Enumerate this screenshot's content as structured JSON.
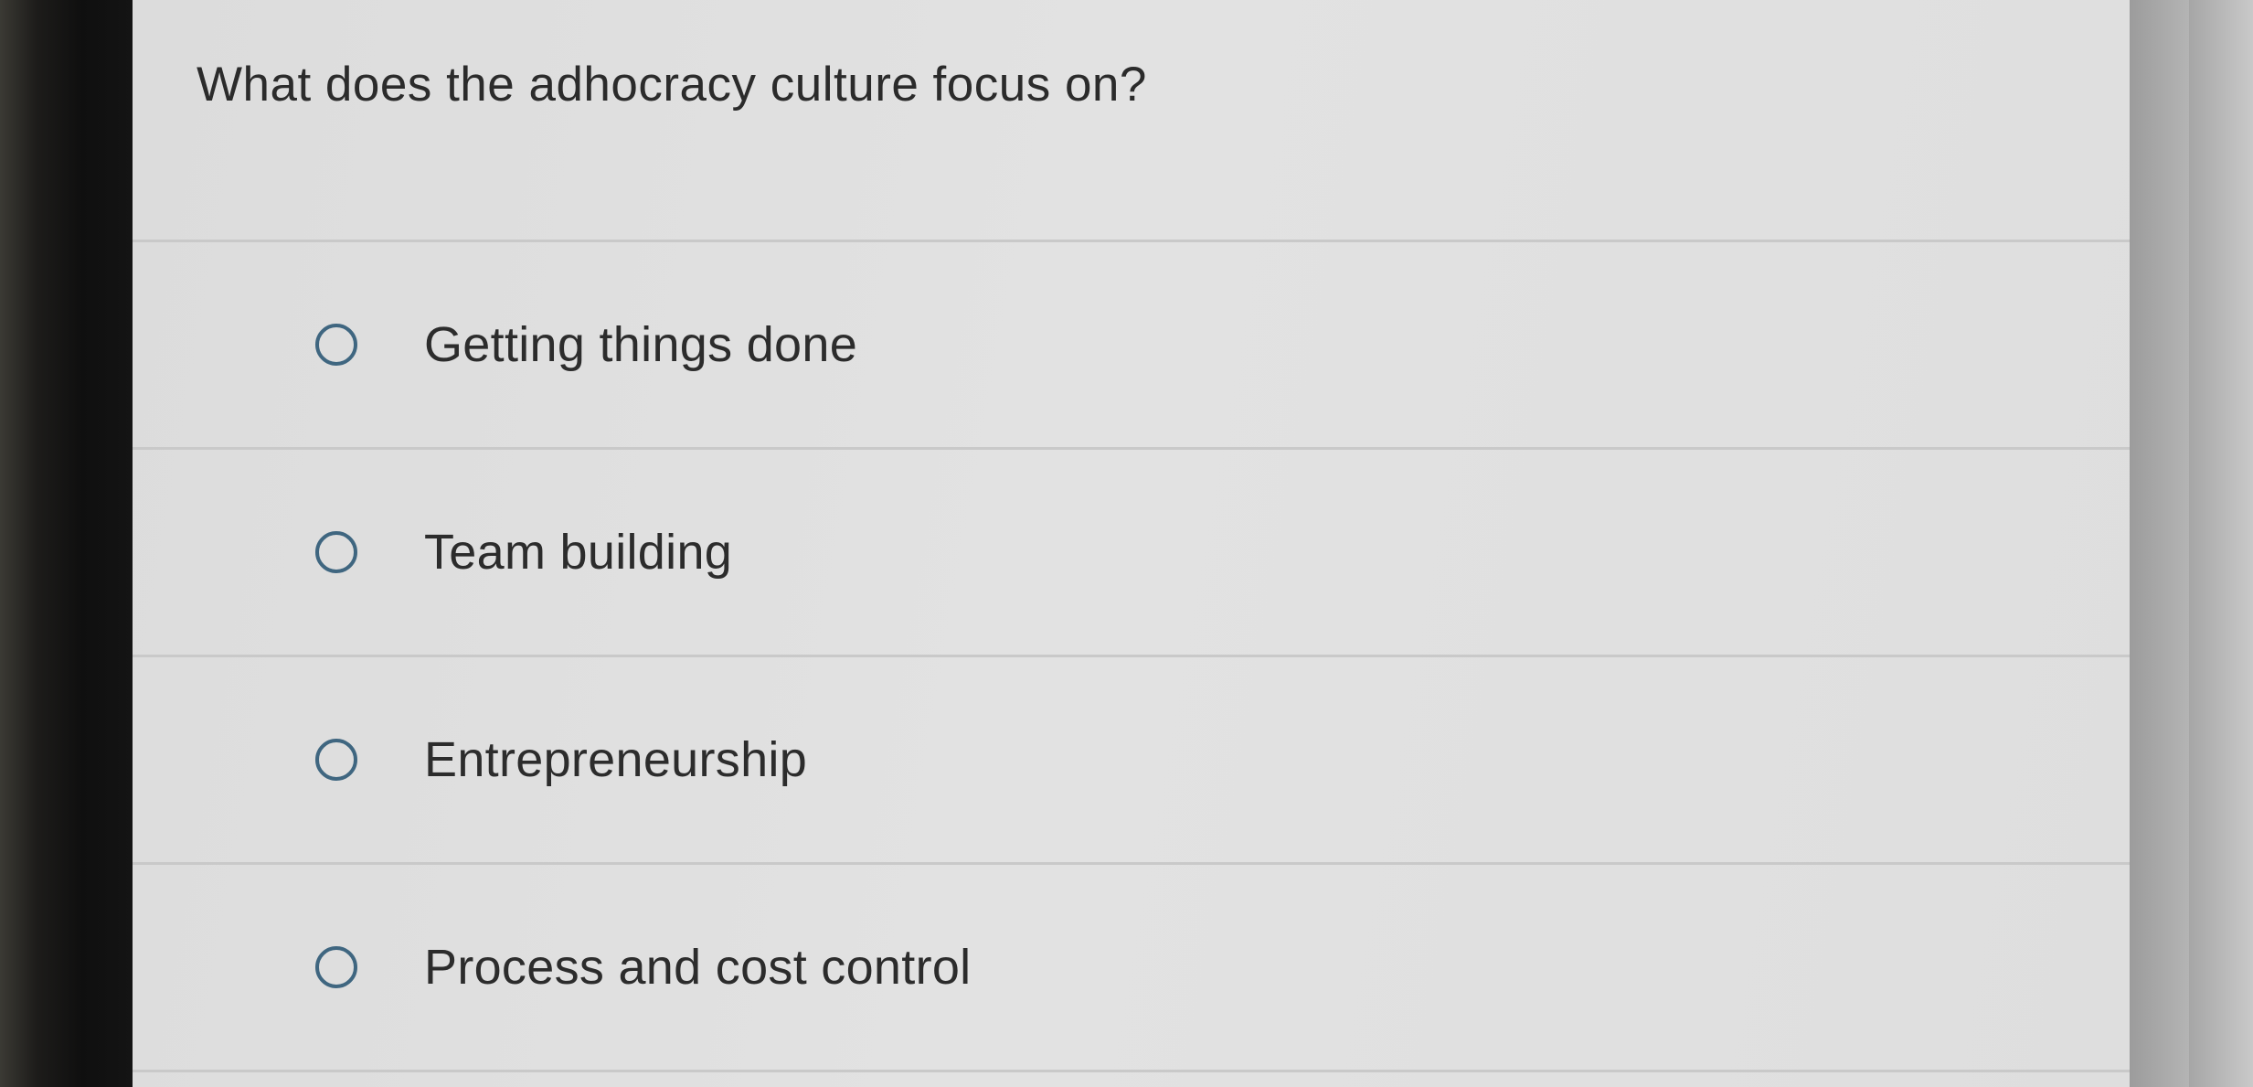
{
  "question": {
    "text": "What does the adhocracy culture focus on?"
  },
  "options": [
    {
      "label": "Getting things done",
      "selected": false
    },
    {
      "label": "Team building",
      "selected": false
    },
    {
      "label": "Entrepreneurship",
      "selected": false
    },
    {
      "label": "Process and cost control",
      "selected": false
    }
  ],
  "colors": {
    "radio_border": "#3f6680",
    "text": "#2c2c2c",
    "background": "#e0e0e0"
  },
  "icons": {
    "radio": "radio-unchecked-icon"
  }
}
